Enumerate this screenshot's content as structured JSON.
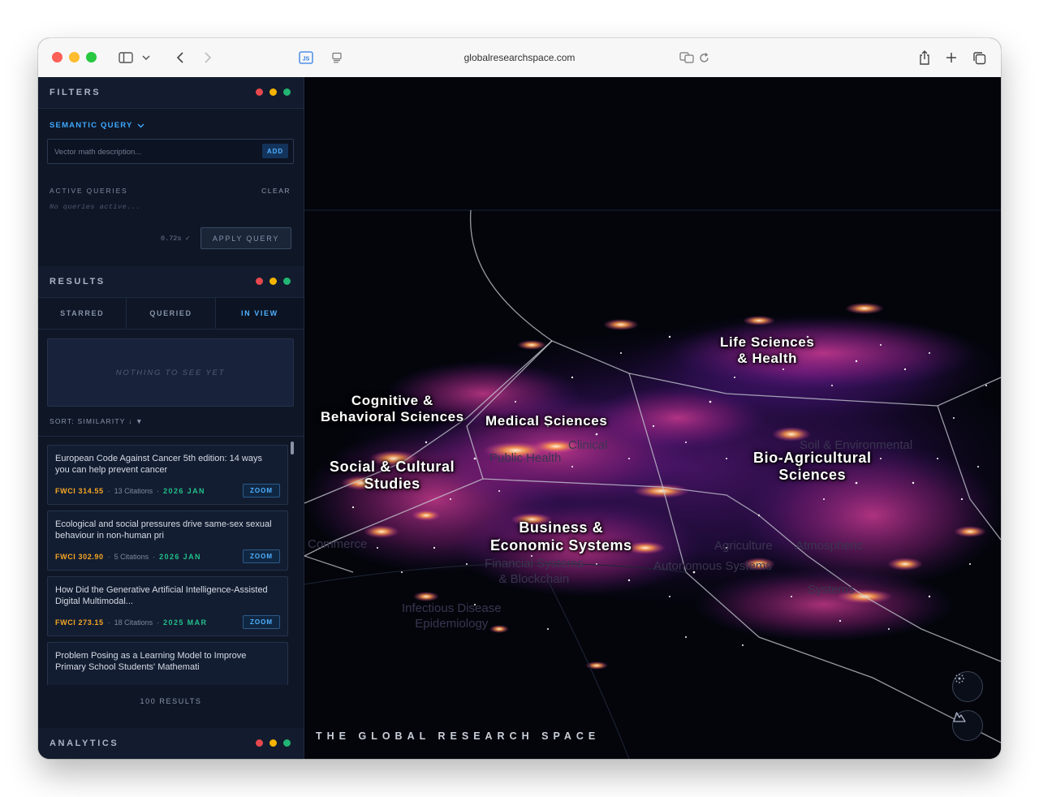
{
  "browser": {
    "url": "globalresearchspace.com"
  },
  "filters": {
    "title": "FILTERS",
    "semantic_query_label": "SEMANTIC QUERY",
    "query_placeholder": "Vector math description...",
    "add_label": "ADD",
    "active_queries_label": "ACTIVE QUERIES",
    "clear_label": "CLEAR",
    "no_queries_text": "No queries active...",
    "timing": "0.72s ✓",
    "apply_label": "APPLY QUERY"
  },
  "results": {
    "title": "RESULTS",
    "tabs": [
      {
        "label": "STARRED"
      },
      {
        "label": "QUERIED"
      },
      {
        "label": "IN VIEW"
      }
    ],
    "active_tab": "IN VIEW",
    "empty_text": "NOTHING TO SEE YET",
    "sort_label": "SORT: SIMILARITY ↓ ▼",
    "items": [
      {
        "title": "European Code Against Cancer 5th edition: 14 ways you can help prevent cancer",
        "fwci": "FWCI 314.55",
        "citations": "13 Citations",
        "date": "2026 JAN",
        "zoom": "ZOOM"
      },
      {
        "title": "Ecological and social pressures drive same-sex sexual behaviour in non-human pri",
        "fwci": "FWCI 302.90",
        "citations": "5 Citations",
        "date": "2026 JAN",
        "zoom": "ZOOM"
      },
      {
        "title": "How Did the Generative Artificial Intelligence-Assisted Digital Multimodal...",
        "fwci": "FWCI 273.15",
        "citations": "18 Citations",
        "date": "2025 MAR",
        "zoom": "ZOOM"
      },
      {
        "title": "Problem Posing as a Learning Model to Improve Primary School Students' Mathemati",
        "fwci": "",
        "citations": "",
        "date": "",
        "zoom": ""
      }
    ],
    "count_text": "100 RESULTS"
  },
  "analytics": {
    "title": "ANALYTICS"
  },
  "map": {
    "brand": "THE GLOBAL RESEARCH SPACE",
    "regions": {
      "life": "Life Sciences\n& Health",
      "cognitive": "Cognitive &\nBehavioral Sciences",
      "medical": "Medical Sciences",
      "social": "Social & Cultural\nStudies",
      "bioag": "Bio-Agricultural\nSciences",
      "business": "Business &\nEconomic Systems"
    },
    "faint_labels": {
      "infectious": "Infectious Disease\nEpidemiology",
      "fintech": "Financial Systems\n& Blockchain",
      "autonomous": "Autonomous Systems",
      "agri": "Agriculture",
      "env": "Soil & Environmental",
      "clinical": "Clinical",
      "health": "Public Health",
      "commerce": "Commerce",
      "atmos": "Atmospheric",
      "systems": "Systems"
    },
    "colors": {
      "glow_core": "#fff1d6",
      "glow_orange": "#ff8a3d",
      "glow_magenta": "#c22f9a",
      "glow_purple": "#5a1a8f",
      "border_lines": "#c9cdd6"
    }
  }
}
